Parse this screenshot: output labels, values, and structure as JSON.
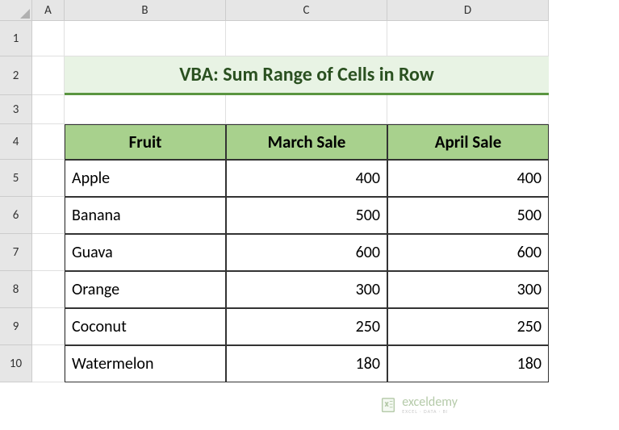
{
  "columns": [
    "A",
    "B",
    "C",
    "D"
  ],
  "rows": [
    "1",
    "2",
    "3",
    "4",
    "5",
    "6",
    "7",
    "8",
    "9",
    "10"
  ],
  "title": "VBA: Sum Range of Cells in Row",
  "headers": {
    "fruit": "Fruit",
    "march": "March Sale",
    "april": "April Sale"
  },
  "chart_data": {
    "type": "table",
    "columns": [
      "Fruit",
      "March Sale",
      "April Sale"
    ],
    "rows": [
      {
        "fruit": "Apple",
        "march": 400,
        "april": 400
      },
      {
        "fruit": "Banana",
        "march": 500,
        "april": 500
      },
      {
        "fruit": "Guava",
        "march": 600,
        "april": 600
      },
      {
        "fruit": "Orange",
        "march": 300,
        "april": 300
      },
      {
        "fruit": "Coconut",
        "march": 250,
        "april": 250
      },
      {
        "fruit": "Watermelon",
        "march": 180,
        "april": 180
      }
    ]
  },
  "watermark": {
    "main": "exceldemy",
    "sub": "EXCEL · DATA · BI"
  }
}
